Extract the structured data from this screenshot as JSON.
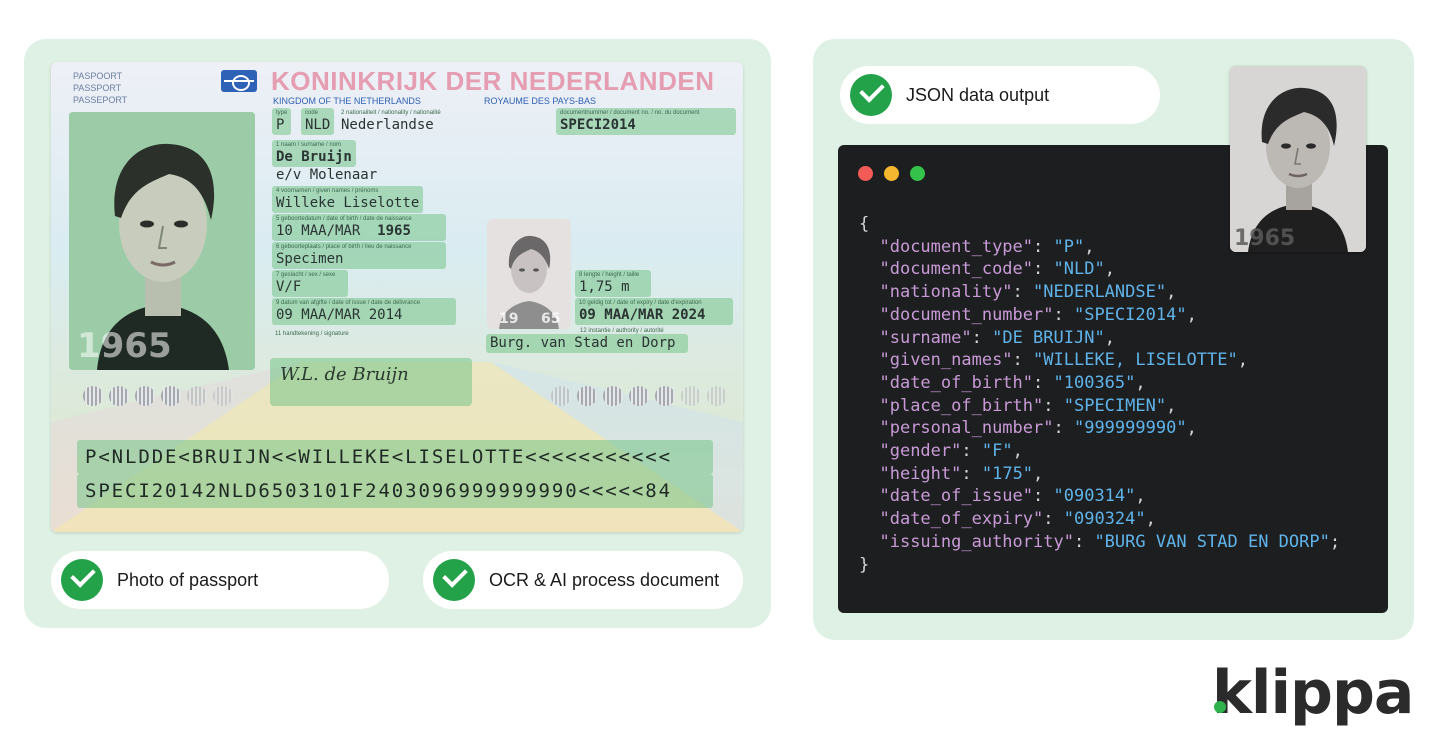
{
  "passport": {
    "doc_type_labels": [
      "PASPOORT",
      "PASSPORT",
      "PASSEPORT"
    ],
    "country_title": "KONINKRIJK DER NEDERLANDEN",
    "country_en": "KINGDOM OF THE NETHERLANDS",
    "country_fr": "ROYAUME DES PAYS-BAS",
    "type_label": "type",
    "type_value": "P",
    "code_label": "code",
    "code_value": "NLD",
    "nationality_label": "2 nationaliteit / nationality / nationalité",
    "nationality_value": "Nederlandse",
    "docnum_label": "documentnummer / document no. / no. du document",
    "docnum_value": "SPECI2014",
    "surname_label": "1 naam / surname / nom",
    "surname_value": "De Bruijn",
    "surname_extra": "e/v Molenaar",
    "given_label": "4 voornamen / given names / prénoms",
    "given_value": "Willeke Liselotte",
    "dob_label": "5 geboortedatum / date of birth / date de naissance",
    "dob_value": "10 MAA/MAR",
    "dob_year": "1965",
    "pob_label": "6 geboorteplaats / place of birth / lieu de naissance",
    "pob_value": "Specimen",
    "sex_label": "7 geslacht / sex / sexe",
    "sex_value": "V/F",
    "issue_label": "9 datum van afgifte / date of issue / date de délivrance",
    "issue_value": "09 MAA/MAR 2014",
    "height_label": "8 lengte / height / taille",
    "height_value": "1,75 m",
    "expiry_label": "10 geldig tot / date of expiry / date d'expiration",
    "expiry_value": "09 MAA/MAR 2024",
    "authority_label": "12 instantie / authority / autorité",
    "authority_value": "Burg. van Stad en Dorp",
    "signature_label": "11 handtekening / signature",
    "signature_value": "W.L. de Bruijn",
    "photo_number": "1965",
    "small_photo_numbers": [
      "19",
      "65"
    ],
    "mrz_line1": "P<NLDDE<BRUIJN<<WILLEKE<LISELOTTE<<<<<<<<<<<",
    "mrz_line2": "SPECI20142NLD6503101F2403096999999990<<<<<84"
  },
  "steps": {
    "photo": "Photo of passport",
    "ocr": "OCR & AI process document",
    "json": "JSON data output"
  },
  "json_output": {
    "open_brace": "{",
    "close_brace": "}",
    "fields": [
      {
        "key": "\"document_type\"",
        "value": "\"P\"",
        "end": ","
      },
      {
        "key": "\"document_code\"",
        "value": "\"NLD\"",
        "end": ","
      },
      {
        "key": "\"nationality\"",
        "value": "\"NEDERLANDSE\"",
        "end": ","
      },
      {
        "key": "\"document_number\"",
        "value": "\"SPECI2014\"",
        "end": ","
      },
      {
        "key": "\"surname\"",
        "value": "\"DE BRUIJN\"",
        "end": ","
      },
      {
        "key": "\"given_names\"",
        "value": "\"WILLEKE, LISELOTTE\"",
        "end": ","
      },
      {
        "key": "\"date_of_birth\"",
        "value": "\"100365\"",
        "end": ","
      },
      {
        "key": "\"place_of_birth\"",
        "value": "\"SPECIMEN\"",
        "end": ","
      },
      {
        "key": "\"personal_number\"",
        "value": "\"999999990\"",
        "end": ","
      },
      {
        "key": "\"gender\"",
        "value": "\"F\"",
        "end": ","
      },
      {
        "key": "\"height\"",
        "value": "\"175\"",
        "end": ","
      },
      {
        "key": "\"date_of_issue\"",
        "value": "\"090314\"",
        "end": ","
      },
      {
        "key": "\"date_of_expiry\"",
        "value": "\"090324\"",
        "end": ","
      },
      {
        "key": "\"issuing_authority\"",
        "value": "\"BURG VAN STAD EN DORP\"",
        "end": ";"
      }
    ]
  },
  "json_photo_number": "1965",
  "brand": {
    "logo_text": "klippa",
    "accent": "#2fb24c"
  },
  "colors": {
    "panel_bg": "#dff1e4",
    "check_green": "#24a24a",
    "code_bg": "#1d1e20",
    "json_key": "#c89ad6",
    "json_value": "#5fb3e8"
  },
  "icons": [
    "check-icon",
    "window-close-dot-icon",
    "window-minimize-dot-icon",
    "window-maximize-dot-icon",
    "passport-emblem-icon"
  ]
}
